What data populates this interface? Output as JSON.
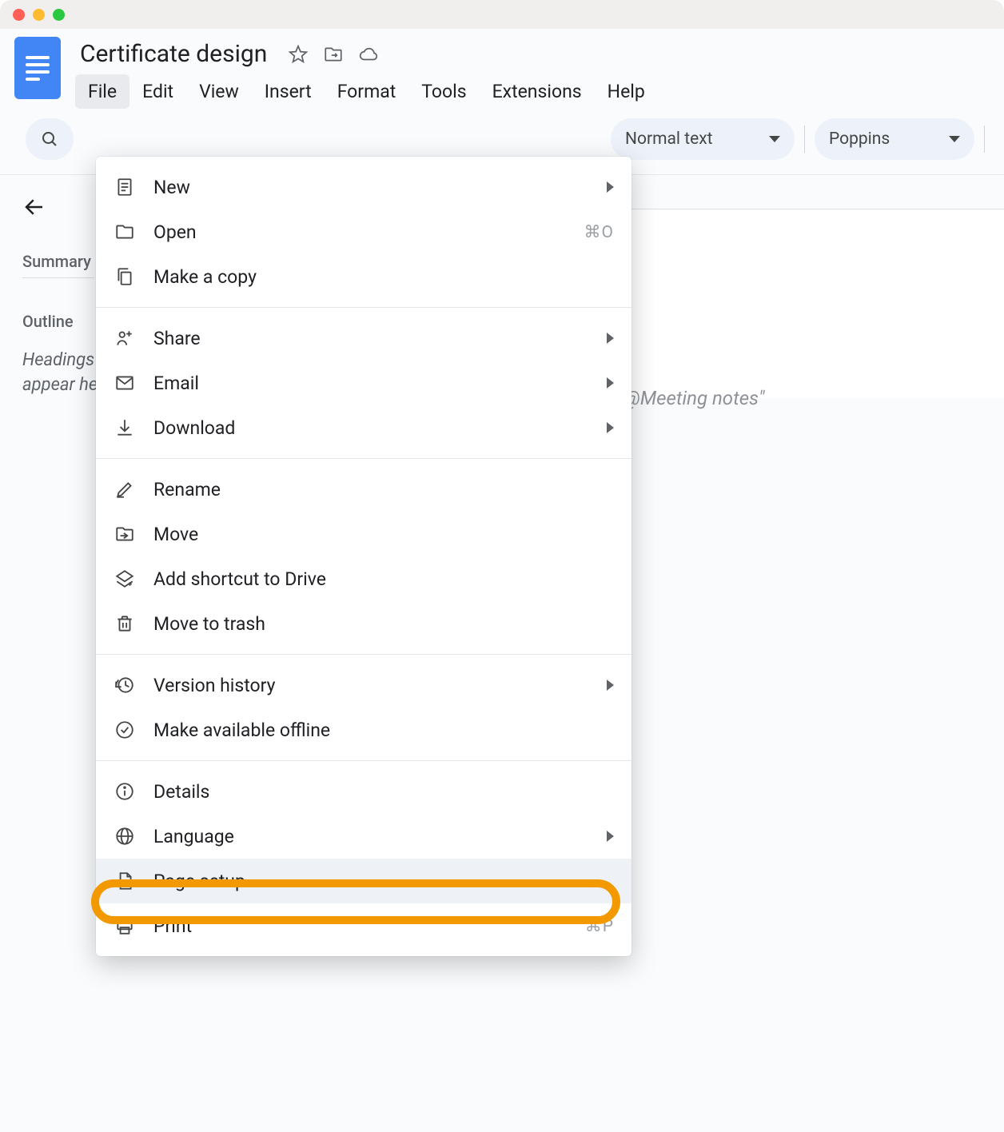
{
  "document": {
    "title": "Certificate design"
  },
  "menubar": [
    "File",
    "Edit",
    "View",
    "Insert",
    "Format",
    "Tools",
    "Extensions",
    "Help"
  ],
  "menubar_active": "File",
  "toolbar": {
    "style_label": "Normal text",
    "font_label": "Poppins"
  },
  "sidebar": {
    "summary_heading": "Summary",
    "outline_heading": "Outline",
    "empty_text_line1": "Headings you add to the document will",
    "empty_text_line2": "appear here."
  },
  "page": {
    "placeholder": "Try \"@Email draft\" to add an email draft or \"@Meeting notes\""
  },
  "file_menu": [
    {
      "icon": "doc",
      "label": "New",
      "submenu": true
    },
    {
      "icon": "folder",
      "label": "Open",
      "shortcut": "⌘O"
    },
    {
      "icon": "copy",
      "label": "Make a copy"
    },
    {
      "divider": true
    },
    {
      "icon": "share",
      "label": "Share",
      "submenu": true
    },
    {
      "icon": "mail",
      "label": "Email",
      "submenu": true
    },
    {
      "icon": "download",
      "label": "Download",
      "submenu": true
    },
    {
      "divider": true
    },
    {
      "icon": "rename",
      "label": "Rename"
    },
    {
      "icon": "move",
      "label": "Move"
    },
    {
      "icon": "shortcut",
      "label": "Add shortcut to Drive"
    },
    {
      "icon": "trash",
      "label": "Move to trash"
    },
    {
      "divider": true
    },
    {
      "icon": "history",
      "label": "Version history",
      "submenu": true
    },
    {
      "icon": "offline",
      "label": "Make available offline"
    },
    {
      "divider": true
    },
    {
      "icon": "info",
      "label": "Details"
    },
    {
      "icon": "globe",
      "label": "Language",
      "submenu": true
    },
    {
      "icon": "page",
      "label": "Page setup",
      "highlight": true
    },
    {
      "icon": "print",
      "label": "Print",
      "shortcut": "⌘P"
    }
  ],
  "highlighted_item_label": "Page setup"
}
